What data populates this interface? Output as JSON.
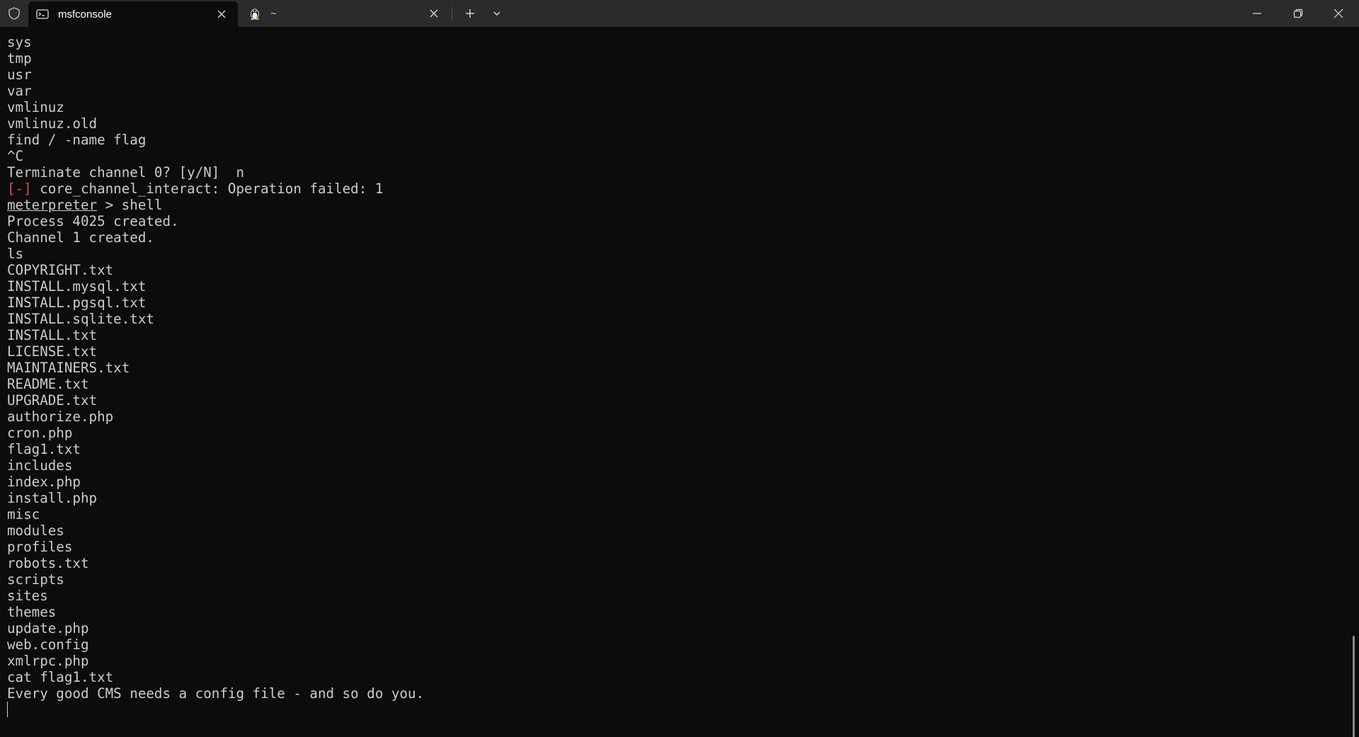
{
  "titlebar": {
    "tabs": [
      {
        "label": "msfconsole",
        "icon": "terminal-icon",
        "active": true
      },
      {
        "label": "~",
        "icon": "linux-penguin-icon",
        "active": false
      }
    ],
    "new_tab_icon": "plus-icon",
    "dropdown_icon": "chevron-down-icon",
    "window_controls": [
      "minimize-icon",
      "restore-icon",
      "close-icon"
    ]
  },
  "terminal": {
    "lines": [
      "sys",
      "tmp",
      "usr",
      "var",
      "vmlinuz",
      "vmlinuz.old",
      "find / -name flag",
      "^C",
      "Terminate channel 0? [y/N]  n",
      {
        "prefix": "[-]",
        "text": " core_channel_interact: Operation failed: 1"
      },
      {
        "prompt": "meterpreter",
        "text": " > shell"
      },
      "Process 4025 created.",
      "Channel 1 created.",
      "ls",
      "COPYRIGHT.txt",
      "INSTALL.mysql.txt",
      "INSTALL.pgsql.txt",
      "INSTALL.sqlite.txt",
      "INSTALL.txt",
      "LICENSE.txt",
      "MAINTAINERS.txt",
      "README.txt",
      "UPGRADE.txt",
      "authorize.php",
      "cron.php",
      "flag1.txt",
      "includes",
      "index.php",
      "install.php",
      "misc",
      "modules",
      "profiles",
      "robots.txt",
      "scripts",
      "sites",
      "themes",
      "update.php",
      "web.config",
      "xmlrpc.php",
      "cat flag1.txt",
      "Every good CMS needs a config file - and so do you."
    ],
    "colors": {
      "background": "#0c0c0c",
      "foreground": "#cccccc",
      "error": "#e74856"
    }
  }
}
